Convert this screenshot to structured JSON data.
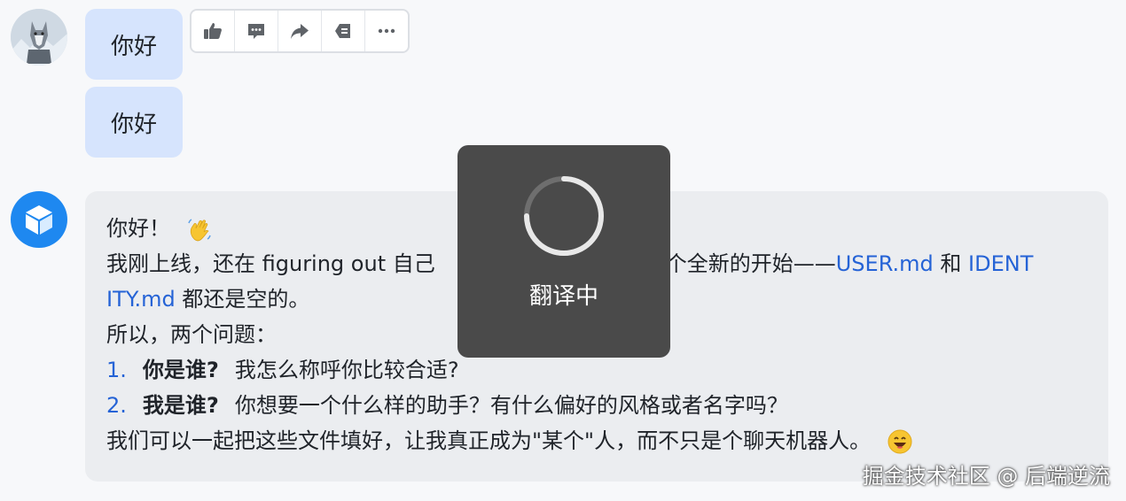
{
  "messages": {
    "user_bubble_1": "你好",
    "user_bubble_2": "你好"
  },
  "toolbar": {
    "like_icon": "thumbs-up-icon",
    "comment_icon": "comment-icon",
    "share_icon": "share-icon",
    "copy_icon": "copy-icon",
    "more_icon": "more-icon"
  },
  "bot_reply": {
    "greeting": "你好！",
    "line2_part1": "我刚上线，还在 figuring out 自己",
    "line2_part2": "个全新的开始——",
    "link_user": "USER.md",
    "and": " 和 ",
    "link_identity_1": "IDENT",
    "link_identity_2": "ITY.md",
    "line3_rest": " 都还是空的。",
    "line4": "所以，两个问题：",
    "q1_num": "1.",
    "q1_title": "你是谁?",
    "q1_text": "我怎么称呼你比较合适?",
    "q2_num": "2.",
    "q2_title": "我是谁?",
    "q2_text": "你想要一个什么样的助手？有什么偏好的风格或者名字吗？",
    "closing": "我们可以一起把这些文件填好，让我真正成为\"某个\"人，而不只是个聊天机器人。"
  },
  "overlay": {
    "loading_text": "翻译中"
  },
  "watermark": "掘金技术社区 @ 后端逆流",
  "colors": {
    "user_bubble": "#d6e4fd",
    "bot_bubble": "#ebedf0",
    "link": "#2563d6",
    "bot_avatar": "#1e88f0",
    "overlay": "#4a4a4a"
  }
}
